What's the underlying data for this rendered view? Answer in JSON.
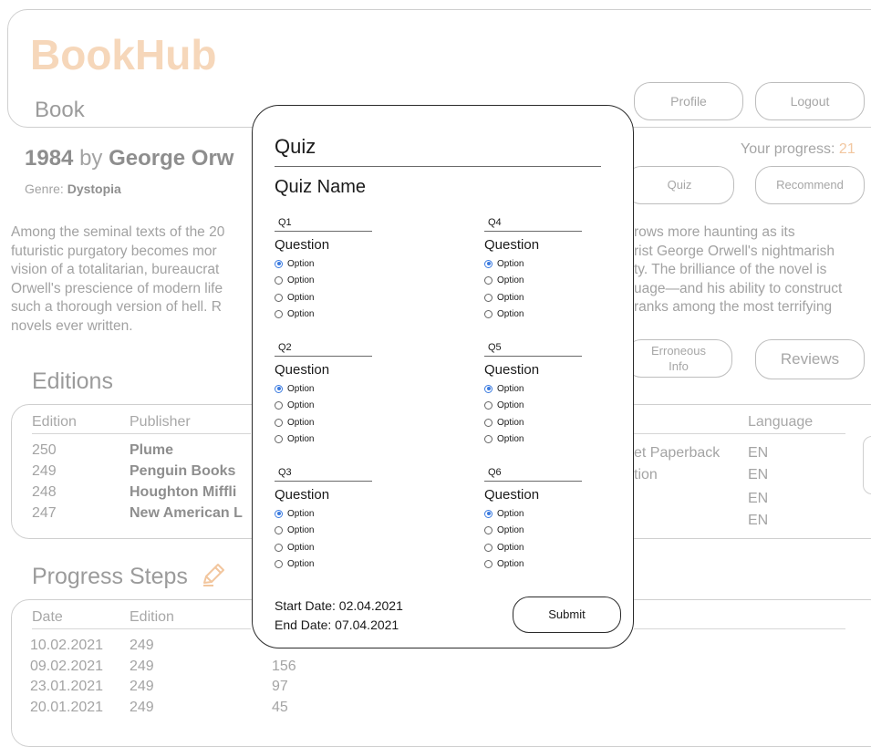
{
  "header": {
    "brand": "BookHub",
    "subtitle": "Book",
    "profile_label": "Profile",
    "logout_label": "Logout"
  },
  "book": {
    "title": "1984",
    "by": "by",
    "author": "George Orw",
    "genre_label": "Genre:",
    "genre": "Dystopia",
    "progress_label": "Your progress:",
    "progress_value": "21",
    "description_left": [
      "Among the seminal texts of the 20",
      "futuristic purgatory becomes mor",
      "vision of a totalitarian, bureaucrat",
      "Orwell's prescience of modern life",
      "such a thorough version of hell. R",
      "novels ever written."
    ],
    "description_right": [
      "rows more haunting as its",
      "rist George Orwell's nightmarish",
      "ty. The brilliance of the novel is",
      "uage—and his ability to construct",
      "ranks among the most terrifying"
    ]
  },
  "actions": {
    "quiz": "Quiz",
    "recommend": "Recommend",
    "erroneous_line1": "Erroneous",
    "erroneous_line2": "Info",
    "reviews": "Reviews"
  },
  "editions": {
    "title": "Editions",
    "headers": {
      "edition": "Edition",
      "publisher": "Publisher",
      "language": "Language"
    },
    "rows": [
      {
        "edition": "250",
        "publisher": "Plume",
        "format": "et Paperback",
        "language": "EN"
      },
      {
        "edition": "249",
        "publisher": "Penguin Books",
        "format": "tion",
        "language": "EN"
      },
      {
        "edition": "248",
        "publisher": "Houghton Miffli",
        "format": "",
        "language": "EN"
      },
      {
        "edition": "247",
        "publisher": "New American L",
        "format": "",
        "language": "EN"
      }
    ]
  },
  "progress_steps": {
    "title": "Progress Steps",
    "headers": {
      "date": "Date",
      "edition": "Edition"
    },
    "rows": [
      {
        "date": "10.02.2021",
        "edition": "249",
        "pages": ""
      },
      {
        "date": "09.02.2021",
        "edition": "249",
        "pages": "156"
      },
      {
        "date": "23.01.2021",
        "edition": "249",
        "pages": "97"
      },
      {
        "date": "20.01.2021",
        "edition": "249",
        "pages": "45"
      }
    ]
  },
  "quiz": {
    "title": "Quiz",
    "name": "Quiz Name",
    "questions": [
      {
        "label": "Q1",
        "text": "Question",
        "options": [
          "Option",
          "Option",
          "Option",
          "Option"
        ],
        "selected": 0
      },
      {
        "label": "Q2",
        "text": "Question",
        "options": [
          "Option",
          "Option",
          "Option",
          "Option"
        ],
        "selected": 0
      },
      {
        "label": "Q3",
        "text": "Question",
        "options": [
          "Option",
          "Option",
          "Option",
          "Option"
        ],
        "selected": 0
      },
      {
        "label": "Q4",
        "text": "Question",
        "options": [
          "Option",
          "Option",
          "Option",
          "Option"
        ],
        "selected": 0
      },
      {
        "label": "Q5",
        "text": "Question",
        "options": [
          "Option",
          "Option",
          "Option",
          "Option"
        ],
        "selected": 0
      },
      {
        "label": "Q6",
        "text": "Question",
        "options": [
          "Option",
          "Option",
          "Option",
          "Option"
        ],
        "selected": 0
      }
    ],
    "start_date": "Start Date: 02.04.2021",
    "end_date": "End Date: 07.04.2021",
    "submit_label": "Submit"
  },
  "colors": {
    "brand": "#f6d7ba",
    "progress_accent": "#f2c7a0",
    "radio_selected": "#3b7be0"
  }
}
